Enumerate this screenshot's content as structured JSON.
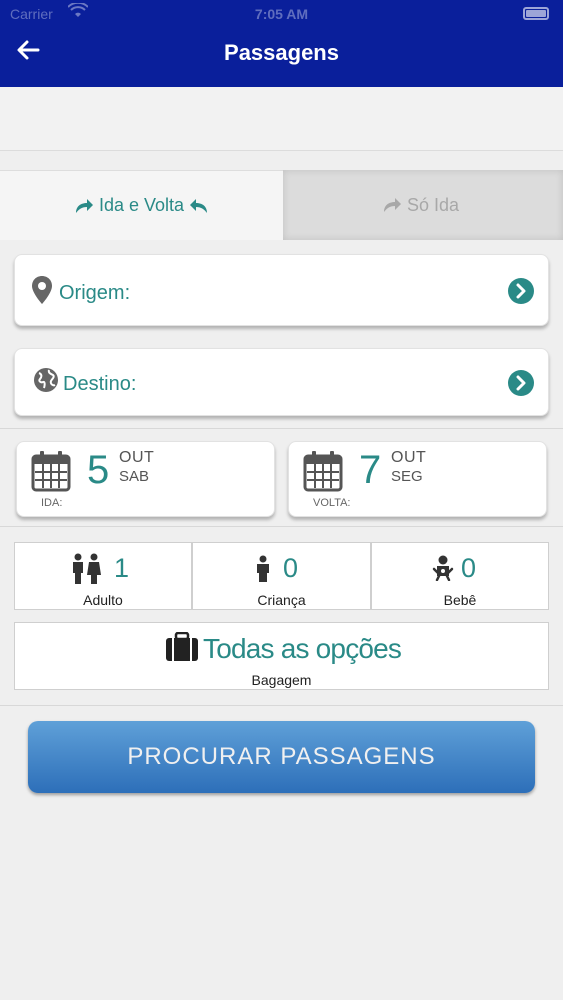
{
  "status_bar": {
    "carrier": "Carrier",
    "time": "7:05 AM"
  },
  "header": {
    "title": "Passagens",
    "back_icon": "arrow-left-icon"
  },
  "trip_tabs": [
    {
      "label": "Ida e Volta",
      "active": true
    },
    {
      "label": "Só Ida",
      "active": false
    }
  ],
  "origin": {
    "label": "Origem:",
    "icon": "map-pin-icon"
  },
  "destination": {
    "label": "Destino:",
    "icon": "globe-icon"
  },
  "dates": {
    "departure": {
      "day": "5",
      "month": "OUT",
      "weekday": "SAB",
      "label": "IDA:"
    },
    "return": {
      "day": "7",
      "month": "OUT",
      "weekday": "SEG",
      "label": "VOLTA:"
    }
  },
  "passengers": [
    {
      "count": "1",
      "label": "Adulto",
      "icon": "adults-icon"
    },
    {
      "count": "0",
      "label": "Criança",
      "icon": "child-icon"
    },
    {
      "count": "0",
      "label": "Bebê",
      "icon": "baby-icon"
    }
  ],
  "baggage": {
    "value": "Todas as opções",
    "label": "Bagagem",
    "icon": "suitcase-icon"
  },
  "search_button": {
    "label": "PROCURAR PASSAGENS"
  },
  "colors": {
    "header": "#0a1f9b",
    "accent": "#2a8a87",
    "button_top": "#5fa0d8",
    "button_bottom": "#2d6fb9"
  }
}
